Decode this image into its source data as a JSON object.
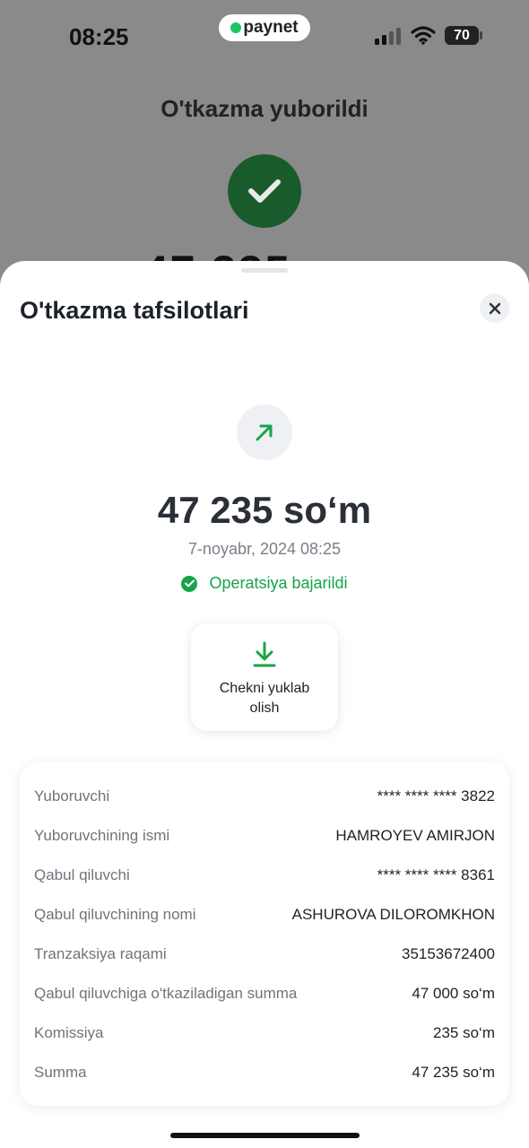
{
  "status_bar": {
    "time": "08:25",
    "brand": "paynet",
    "battery": "70"
  },
  "background": {
    "title": "O'tkazma yuborildi",
    "amount_peek": "47 235"
  },
  "sheet": {
    "title": "O'tkazma tafsilotlari",
    "amount": "47 235 so‘m",
    "datetime": "7-noyabr, 2024 08:25",
    "status": "Operatsiya bajarildi",
    "download_label": "Chekni yuklab olish"
  },
  "details": [
    {
      "label": "Yuboruvchi",
      "value": "**** **** **** 3822"
    },
    {
      "label": "Yuboruvchining ismi",
      "value": "HAMROYEV AMIRJON"
    },
    {
      "label": "Qabul qiluvchi",
      "value": "**** **** **** 8361"
    },
    {
      "label": "Qabul qiluvchining nomi",
      "value": "ASHUROVA DILOROMKHON"
    },
    {
      "label": "Tranzaksiya raqami",
      "value": "35153672400"
    },
    {
      "label": "Qabul qiluvchiga o'tkaziladigan summa",
      "value": "47 000 so‘m"
    },
    {
      "label": "Komissiya",
      "value": "235 so‘m"
    },
    {
      "label": "Summa",
      "value": "47 235 so‘m"
    }
  ],
  "colors": {
    "success": "#18a34a",
    "dark_success": "#1a5b2c"
  },
  "icons": [
    "check-icon",
    "close-icon",
    "arrow-up-right-icon",
    "download-icon",
    "signal-icon",
    "wifi-icon",
    "battery-icon"
  ]
}
